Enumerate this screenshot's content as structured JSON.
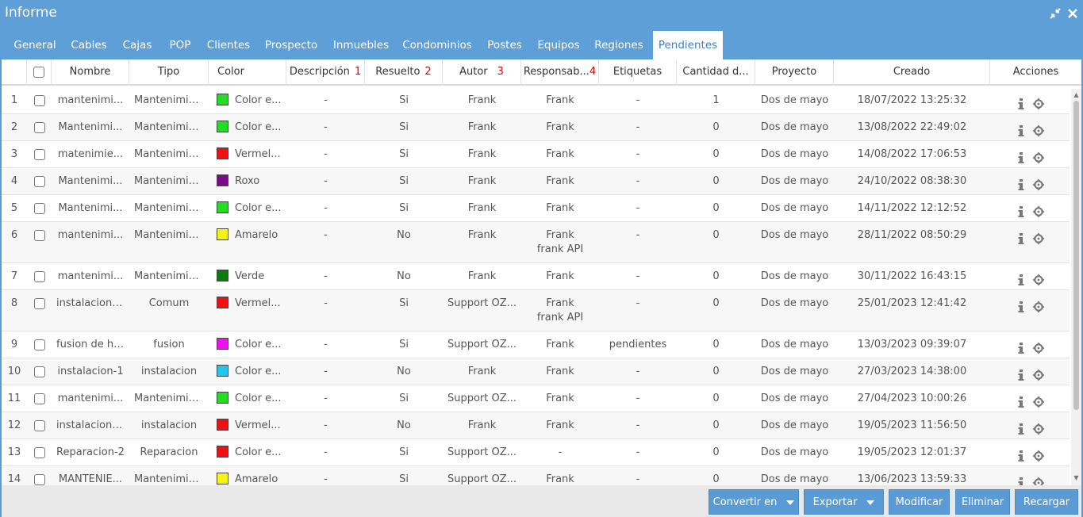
{
  "window": {
    "title": "Informe",
    "restore_icon": "compress-icon",
    "close_icon": "close-icon"
  },
  "tabs": [
    {
      "label": "General"
    },
    {
      "label": "Cables"
    },
    {
      "label": "Cajas"
    },
    {
      "label": "POP"
    },
    {
      "label": "Clientes"
    },
    {
      "label": "Prospecto"
    },
    {
      "label": "Inmuebles"
    },
    {
      "label": "Condominios"
    },
    {
      "label": "Postes"
    },
    {
      "label": "Equipos"
    },
    {
      "label": "Regiones"
    },
    {
      "label": "Pendientes"
    }
  ],
  "active_tab": "Pendientes",
  "columns": [
    {
      "label": ""
    },
    {
      "label": ""
    },
    {
      "label": "Nombre"
    },
    {
      "label": "Tipo"
    },
    {
      "label": "Color"
    },
    {
      "label": "Descripción",
      "marker": "1"
    },
    {
      "label": "Resuelto",
      "marker": "2"
    },
    {
      "label": "Autor",
      "marker": "3"
    },
    {
      "label": "Responsab...",
      "marker": "4"
    },
    {
      "label": "Etiquetas"
    },
    {
      "label": "Cantidad d..."
    },
    {
      "label": "Proyecto"
    },
    {
      "label": "Creado"
    },
    {
      "label": "Acciones"
    }
  ],
  "rows": [
    {
      "n": "1",
      "nombre": "mantenimi...",
      "tipo": "Mantenimie...",
      "color": "#22dd22",
      "color_txt": "Color e...",
      "desc": "-",
      "res": "Si",
      "autor": "Frank",
      "resp": "Frank",
      "resp2": "",
      "etq": "-",
      "cant": "1",
      "proy": "Dos de mayo",
      "creado": "18/07/2022 13:25:32"
    },
    {
      "n": "2",
      "nombre": "Mantenimi...",
      "tipo": "Mantenimie...",
      "color": "#22dd22",
      "color_txt": "Color e...",
      "desc": "-",
      "res": "Si",
      "autor": "Frank",
      "resp": "Frank",
      "resp2": "",
      "etq": "-",
      "cant": "0",
      "proy": "Dos de mayo",
      "creado": "13/08/2022 22:49:02"
    },
    {
      "n": "3",
      "nombre": "matenimie...",
      "tipo": "Mantenimie...",
      "color": "#ee1111",
      "color_txt": "Vermel...",
      "desc": "-",
      "res": "Si",
      "autor": "Frank",
      "resp": "Frank",
      "resp2": "",
      "etq": "-",
      "cant": "0",
      "proy": "Dos de mayo",
      "creado": "14/08/2022 17:06:53"
    },
    {
      "n": "4",
      "nombre": "Mantenimi...",
      "tipo": "Mantenimie...",
      "color": "#7a0c86",
      "color_txt": "Roxo",
      "desc": "-",
      "res": "Si",
      "autor": "Frank",
      "resp": "Frank",
      "resp2": "",
      "etq": "-",
      "cant": "0",
      "proy": "Dos de mayo",
      "creado": "24/10/2022 08:38:30"
    },
    {
      "n": "5",
      "nombre": "Mantenimi...",
      "tipo": "Mantenimie...",
      "color": "#22dd22",
      "color_txt": "Color e...",
      "desc": "-",
      "res": "Si",
      "autor": "Frank",
      "resp": "Frank",
      "resp2": "",
      "etq": "-",
      "cant": "0",
      "proy": "Dos de mayo",
      "creado": "14/11/2022 12:12:52"
    },
    {
      "n": "6",
      "nombre": "mantenimi...",
      "tipo": "Mantenimie...",
      "color": "#f5f511",
      "color_txt": "Amarelo",
      "desc": "-",
      "res": "No",
      "autor": "Frank",
      "resp": "Frank",
      "resp2": "frank API",
      "etq": "-",
      "cant": "0",
      "proy": "Dos de mayo",
      "creado": "28/11/2022 08:50:29"
    },
    {
      "n": "7",
      "nombre": "mantenimi...",
      "tipo": "Mantenimie...",
      "color": "#0d7a0d",
      "color_txt": "Verde",
      "desc": "-",
      "res": "No",
      "autor": "Frank",
      "resp": "Frank",
      "resp2": "",
      "etq": "-",
      "cant": "0",
      "proy": "Dos de mayo",
      "creado": "30/11/2022 16:43:15"
    },
    {
      "n": "8",
      "nombre": "instalacion ...",
      "tipo": "Comum",
      "color": "#ee1111",
      "color_txt": "Vermel...",
      "desc": "-",
      "res": "Si",
      "autor": "Support OZ...",
      "resp": "Frank",
      "resp2": "frank API",
      "etq": "-",
      "cant": "0",
      "proy": "Dos de mayo",
      "creado": "25/01/2023 12:41:42"
    },
    {
      "n": "9",
      "nombre": "fusion de hi...",
      "tipo": "fusion",
      "color": "#ee11ee",
      "color_txt": "Color e...",
      "desc": "-",
      "res": "Si",
      "autor": "Support OZ...",
      "resp": "Frank",
      "resp2": "",
      "etq": "pendientes",
      "cant": "0",
      "proy": "Dos de mayo",
      "creado": "13/03/2023 09:39:07"
    },
    {
      "n": "10",
      "nombre": "instalacion-1",
      "tipo": "instalacion",
      "color": "#22c6ee",
      "color_txt": "Color e...",
      "desc": "-",
      "res": "No",
      "autor": "Frank",
      "resp": "Frank",
      "resp2": "",
      "etq": "-",
      "cant": "0",
      "proy": "Dos de mayo",
      "creado": "27/03/2023 14:38:00"
    },
    {
      "n": "11",
      "nombre": "mantenimi...",
      "tipo": "Mantenimie...",
      "color": "#22dd22",
      "color_txt": "Color e...",
      "desc": "-",
      "res": "Si",
      "autor": "Support OZ...",
      "resp": "Frank",
      "resp2": "",
      "etq": "-",
      "cant": "0",
      "proy": "Dos de mayo",
      "creado": "27/04/2023 10:00:26"
    },
    {
      "n": "12",
      "nombre": "instalacion ...",
      "tipo": "instalacion",
      "color": "#ee1111",
      "color_txt": "Vermel...",
      "desc": "-",
      "res": "No",
      "autor": "Frank",
      "resp": "Frank",
      "resp2": "",
      "etq": "-",
      "cant": "0",
      "proy": "Dos de mayo",
      "creado": "19/05/2023 11:56:50"
    },
    {
      "n": "13",
      "nombre": "Reparacion-2",
      "tipo": "Reparacion",
      "color": "#ee1111",
      "color_txt": "Color e...",
      "desc": "-",
      "res": "Si",
      "autor": "Support OZ...",
      "resp": "-",
      "resp2": "",
      "etq": "-",
      "cant": "0",
      "proy": "Dos de mayo",
      "creado": "19/05/2023 12:01:37"
    },
    {
      "n": "14",
      "nombre": "MANTENIE...",
      "tipo": "Mantenimie...",
      "color": "#f5f511",
      "color_txt": "Amarelo",
      "desc": "-",
      "res": "Si",
      "autor": "Support OZ...",
      "resp": "Frank",
      "resp2": "",
      "etq": "-",
      "cant": "0",
      "proy": "Dos de mayo",
      "creado": "13/06/2023 13:59:33"
    }
  ],
  "footer": {
    "convert": "Convertir en",
    "export": "Exportar",
    "modify": "Modificar",
    "delete": "Eliminar",
    "reload": "Recargar"
  }
}
